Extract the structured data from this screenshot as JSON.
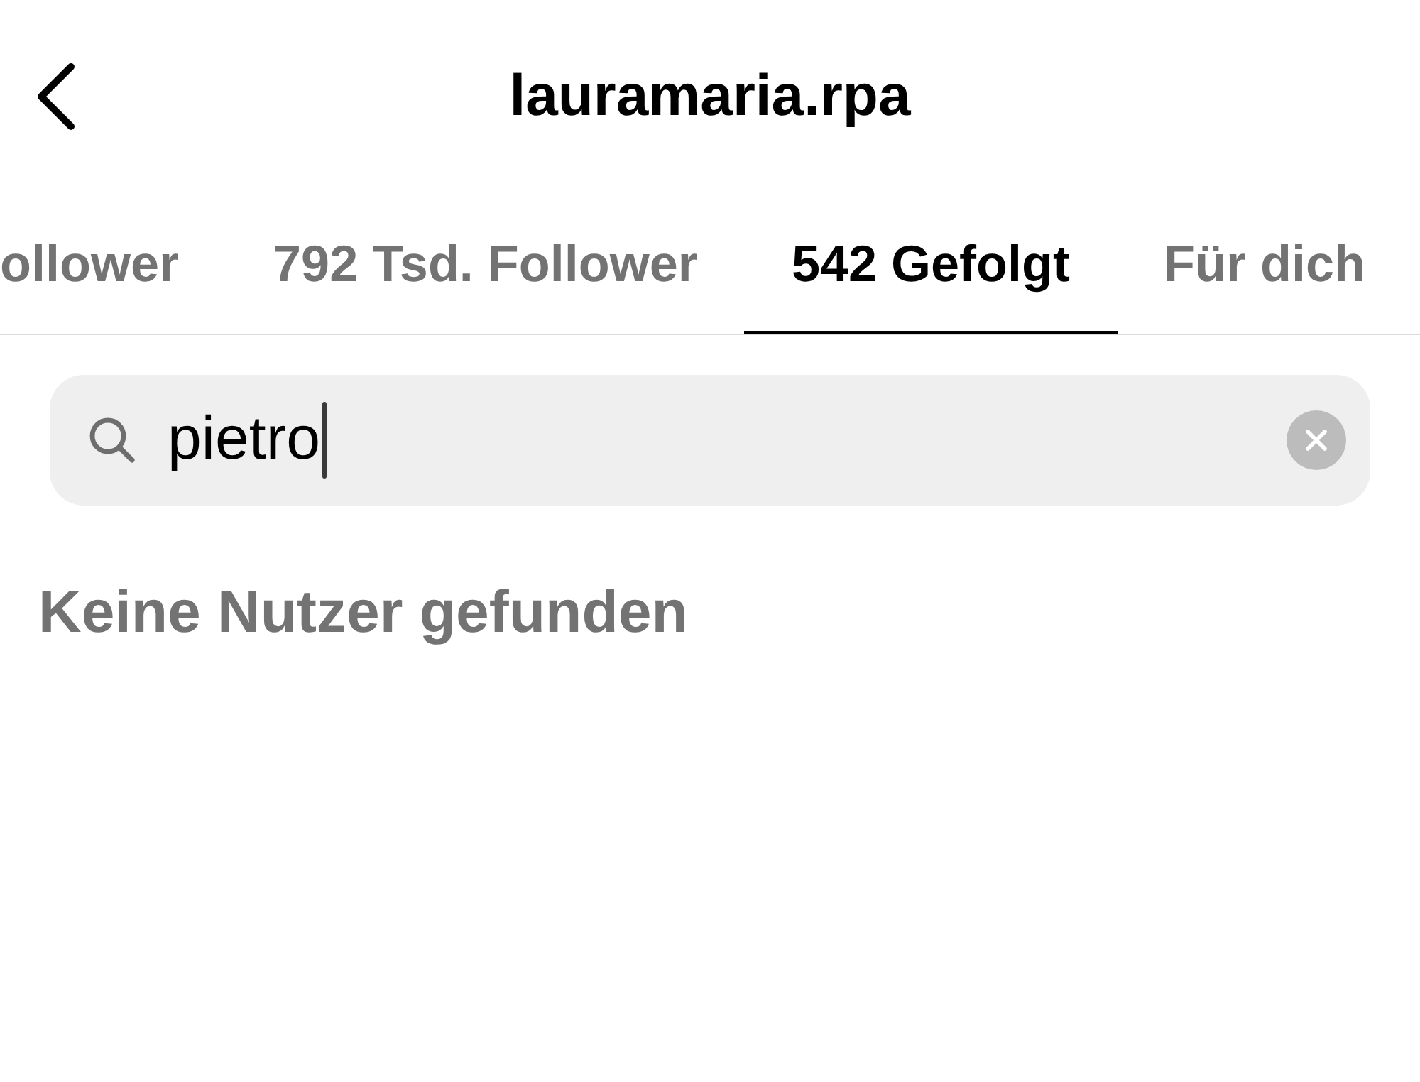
{
  "header": {
    "title": "lauramaria.rpa"
  },
  "tabs": [
    {
      "label": "ollower",
      "selected": false
    },
    {
      "label": "792 Tsd. Follower",
      "selected": false
    },
    {
      "label": "542 Gefolgt",
      "selected": true
    },
    {
      "label": "Für dich",
      "selected": false
    }
  ],
  "search": {
    "value": "pietro",
    "focused": true
  },
  "empty_message": "Keine Nutzer gefunden"
}
